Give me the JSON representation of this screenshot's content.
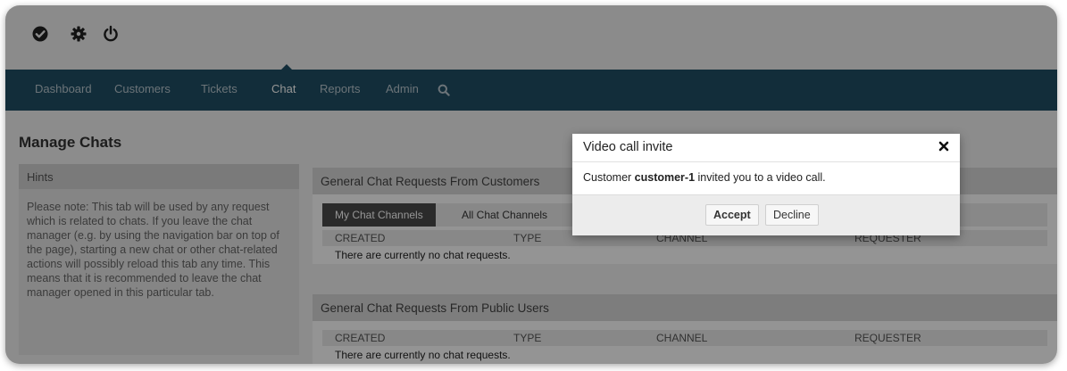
{
  "toolbar": {
    "icons": [
      "check-circle-icon",
      "gear-icon",
      "power-icon"
    ]
  },
  "nav": {
    "items": [
      {
        "label": "Dashboard"
      },
      {
        "label": "Customers"
      },
      {
        "label": "Tickets"
      },
      {
        "label": "Chat"
      },
      {
        "label": "Reports"
      },
      {
        "label": "Admin"
      }
    ],
    "active": "Chat",
    "search_icon": "search-icon"
  },
  "page": {
    "title": "Manage Chats"
  },
  "hints": {
    "title": "Hints",
    "text": "Please note: This tab will be used by any request which is related to chats. If you leave the chat manager (e.g. by using the navigation bar on top of the page), starting a new chat or other chat-related actions will possibly reload this tab any time. This means that it is recommended to leave the chat manager opened in this particular tab."
  },
  "customers_panel": {
    "title": "General Chat Requests From Customers",
    "tabs": [
      {
        "label": "My Chat Channels"
      },
      {
        "label": "All Chat Channels"
      }
    ],
    "columns": [
      "CREATED",
      "TYPE",
      "CHANNEL",
      "REQUESTER"
    ],
    "empty_text": "There are currently no chat requests."
  },
  "public_panel": {
    "title": "General Chat Requests From Public Users",
    "columns": [
      "CREATED",
      "TYPE",
      "CHANNEL",
      "REQUESTER"
    ],
    "empty_text": "There are currently no chat requests."
  },
  "modal": {
    "title": "Video call invite",
    "close_icon": "close-icon",
    "message_prefix": "Customer ",
    "customer": "customer-1",
    "message_suffix": " invited you to a video call.",
    "accept_label": "Accept",
    "decline_label": "Decline"
  },
  "colors": {
    "nav_bg": "#1f4e64",
    "active_tab_bg": "#4a4a4a"
  }
}
